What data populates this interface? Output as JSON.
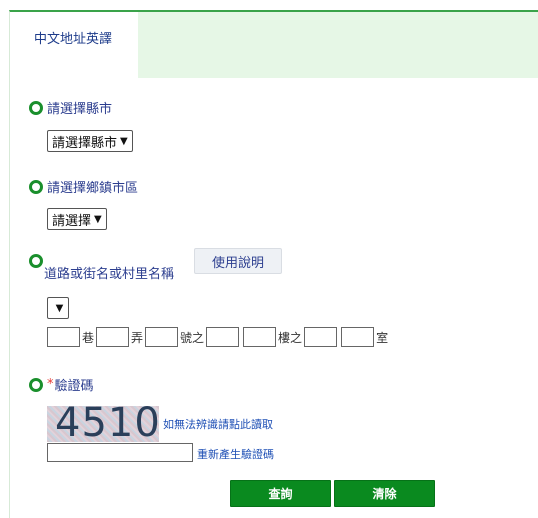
{
  "tab": {
    "label": "中文地址英譯"
  },
  "county": {
    "label": "請選擇縣市",
    "selected": "請選擇縣市"
  },
  "district": {
    "label": "請選擇鄉鎮市區",
    "selected": "請選擇"
  },
  "road": {
    "label": "道路或街名或村里名稱",
    "help_label": "使用說明",
    "selected": ""
  },
  "address_parts": {
    "lane": "巷",
    "alley": "弄",
    "number_of": "號之",
    "floor_of": "樓之",
    "room": "室"
  },
  "captcha": {
    "required_mark": "*",
    "label": "驗證碼",
    "image_text": "4510",
    "hard_to_read_link": "如無法辨識請點此讀取",
    "regenerate_link": "重新產生驗證碼",
    "input_value": ""
  },
  "buttons": {
    "query": "查詢",
    "clear": "清除"
  },
  "colors": {
    "accent": "#1a8f2c",
    "tab_bg": "#e6f7e6",
    "button_bg": "#0a8a1f",
    "label_text": "#2c3e8f"
  }
}
